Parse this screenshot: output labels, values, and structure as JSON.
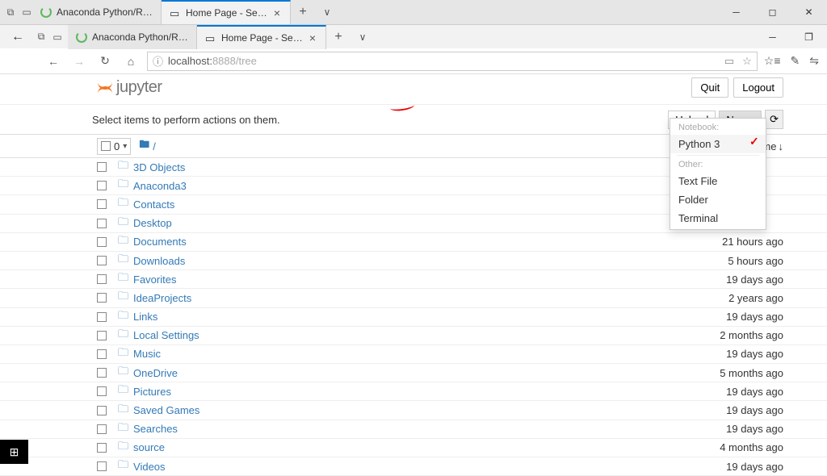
{
  "browser": {
    "tabs_top": [
      {
        "title": "Anaconda Python/R Distribu",
        "active": false
      },
      {
        "title": "Home Page - Select or c",
        "active": true
      }
    ],
    "tabs_row2": [
      {
        "title": "Anaconda Python/R Distribu"
      },
      {
        "title": "Home Page - Select or c"
      }
    ],
    "url_host": "localhost:",
    "url_port": "8888",
    "url_path": "/tree"
  },
  "jupyter": {
    "logo_text": "jupyter",
    "quit_label": "Quit",
    "logout_label": "Logout",
    "hint": "Select items to perform actions on them.",
    "upload_label": "Upload",
    "new_label": "New",
    "select_count": "0",
    "breadcrumb_root": "/",
    "sort_name": "Name",
    "dropdown": {
      "section1": "Notebook:",
      "python3": "Python 3",
      "section2": "Other:",
      "textfile": "Text File",
      "folder": "Folder",
      "terminal": "Terminal"
    },
    "files": [
      {
        "name": "3D Objects",
        "time": ""
      },
      {
        "name": "Anaconda3",
        "time": ""
      },
      {
        "name": "Contacts",
        "time": ""
      },
      {
        "name": "Desktop",
        "time": ""
      },
      {
        "name": "Documents",
        "time": "21 hours ago"
      },
      {
        "name": "Downloads",
        "time": "5 hours ago"
      },
      {
        "name": "Favorites",
        "time": "19 days ago"
      },
      {
        "name": "IdeaProjects",
        "time": "2 years ago"
      },
      {
        "name": "Links",
        "time": "19 days ago"
      },
      {
        "name": "Local Settings",
        "time": "2 months ago"
      },
      {
        "name": "Music",
        "time": "19 days ago"
      },
      {
        "name": "OneDrive",
        "time": "5 months ago"
      },
      {
        "name": "Pictures",
        "time": "19 days ago"
      },
      {
        "name": "Saved Games",
        "time": "19 days ago"
      },
      {
        "name": "Searches",
        "time": "19 days ago"
      },
      {
        "name": "source",
        "time": "4 months ago"
      },
      {
        "name": "Videos",
        "time": "19 days ago"
      }
    ]
  }
}
